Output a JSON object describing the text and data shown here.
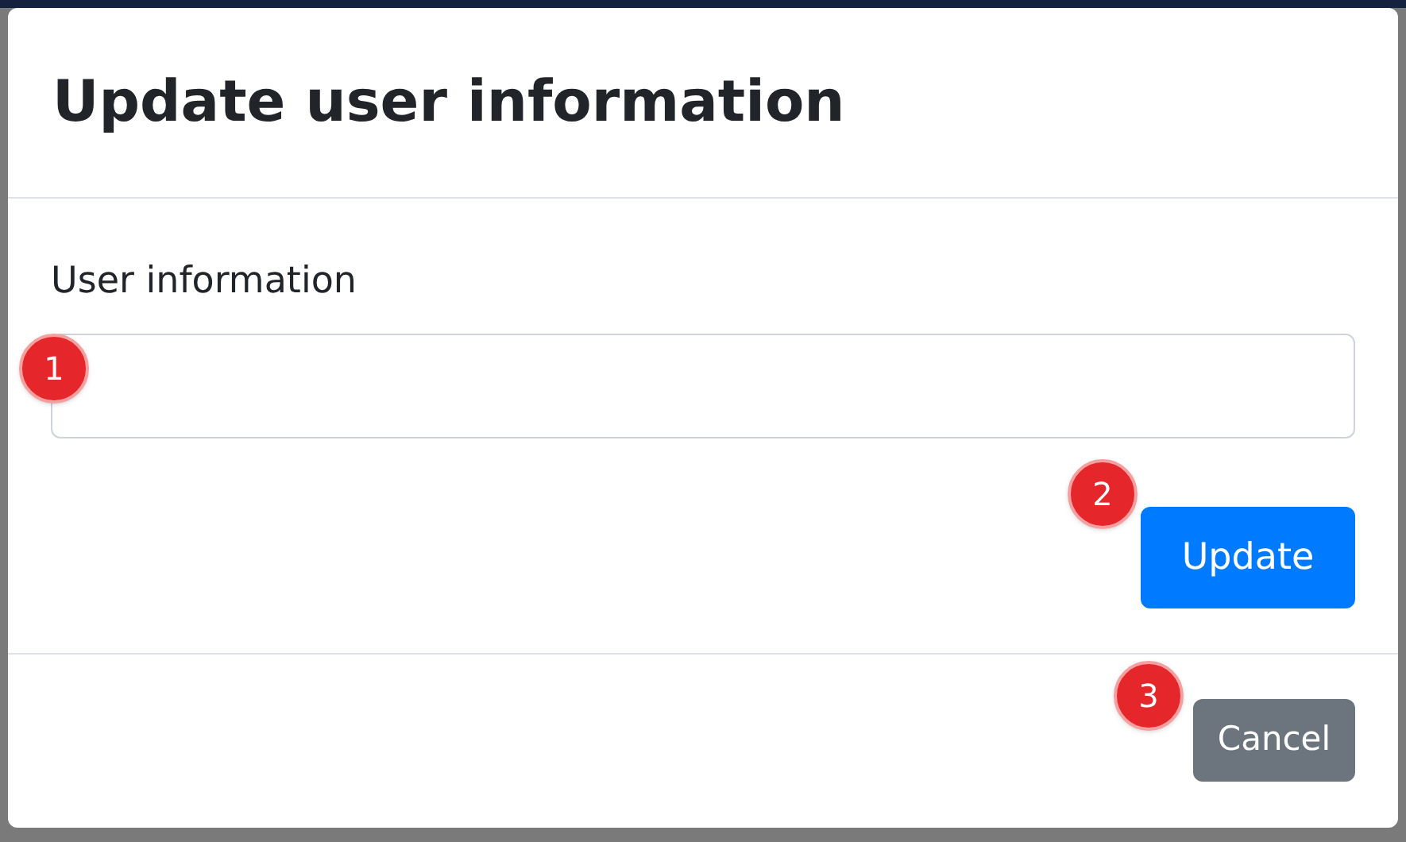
{
  "modal": {
    "title": "Update user information",
    "field": {
      "label": "User information",
      "marker": "1"
    },
    "update_button": {
      "label": "Update",
      "marker": "2"
    },
    "cancel_button": {
      "label": "Cancel",
      "marker": "3"
    }
  }
}
